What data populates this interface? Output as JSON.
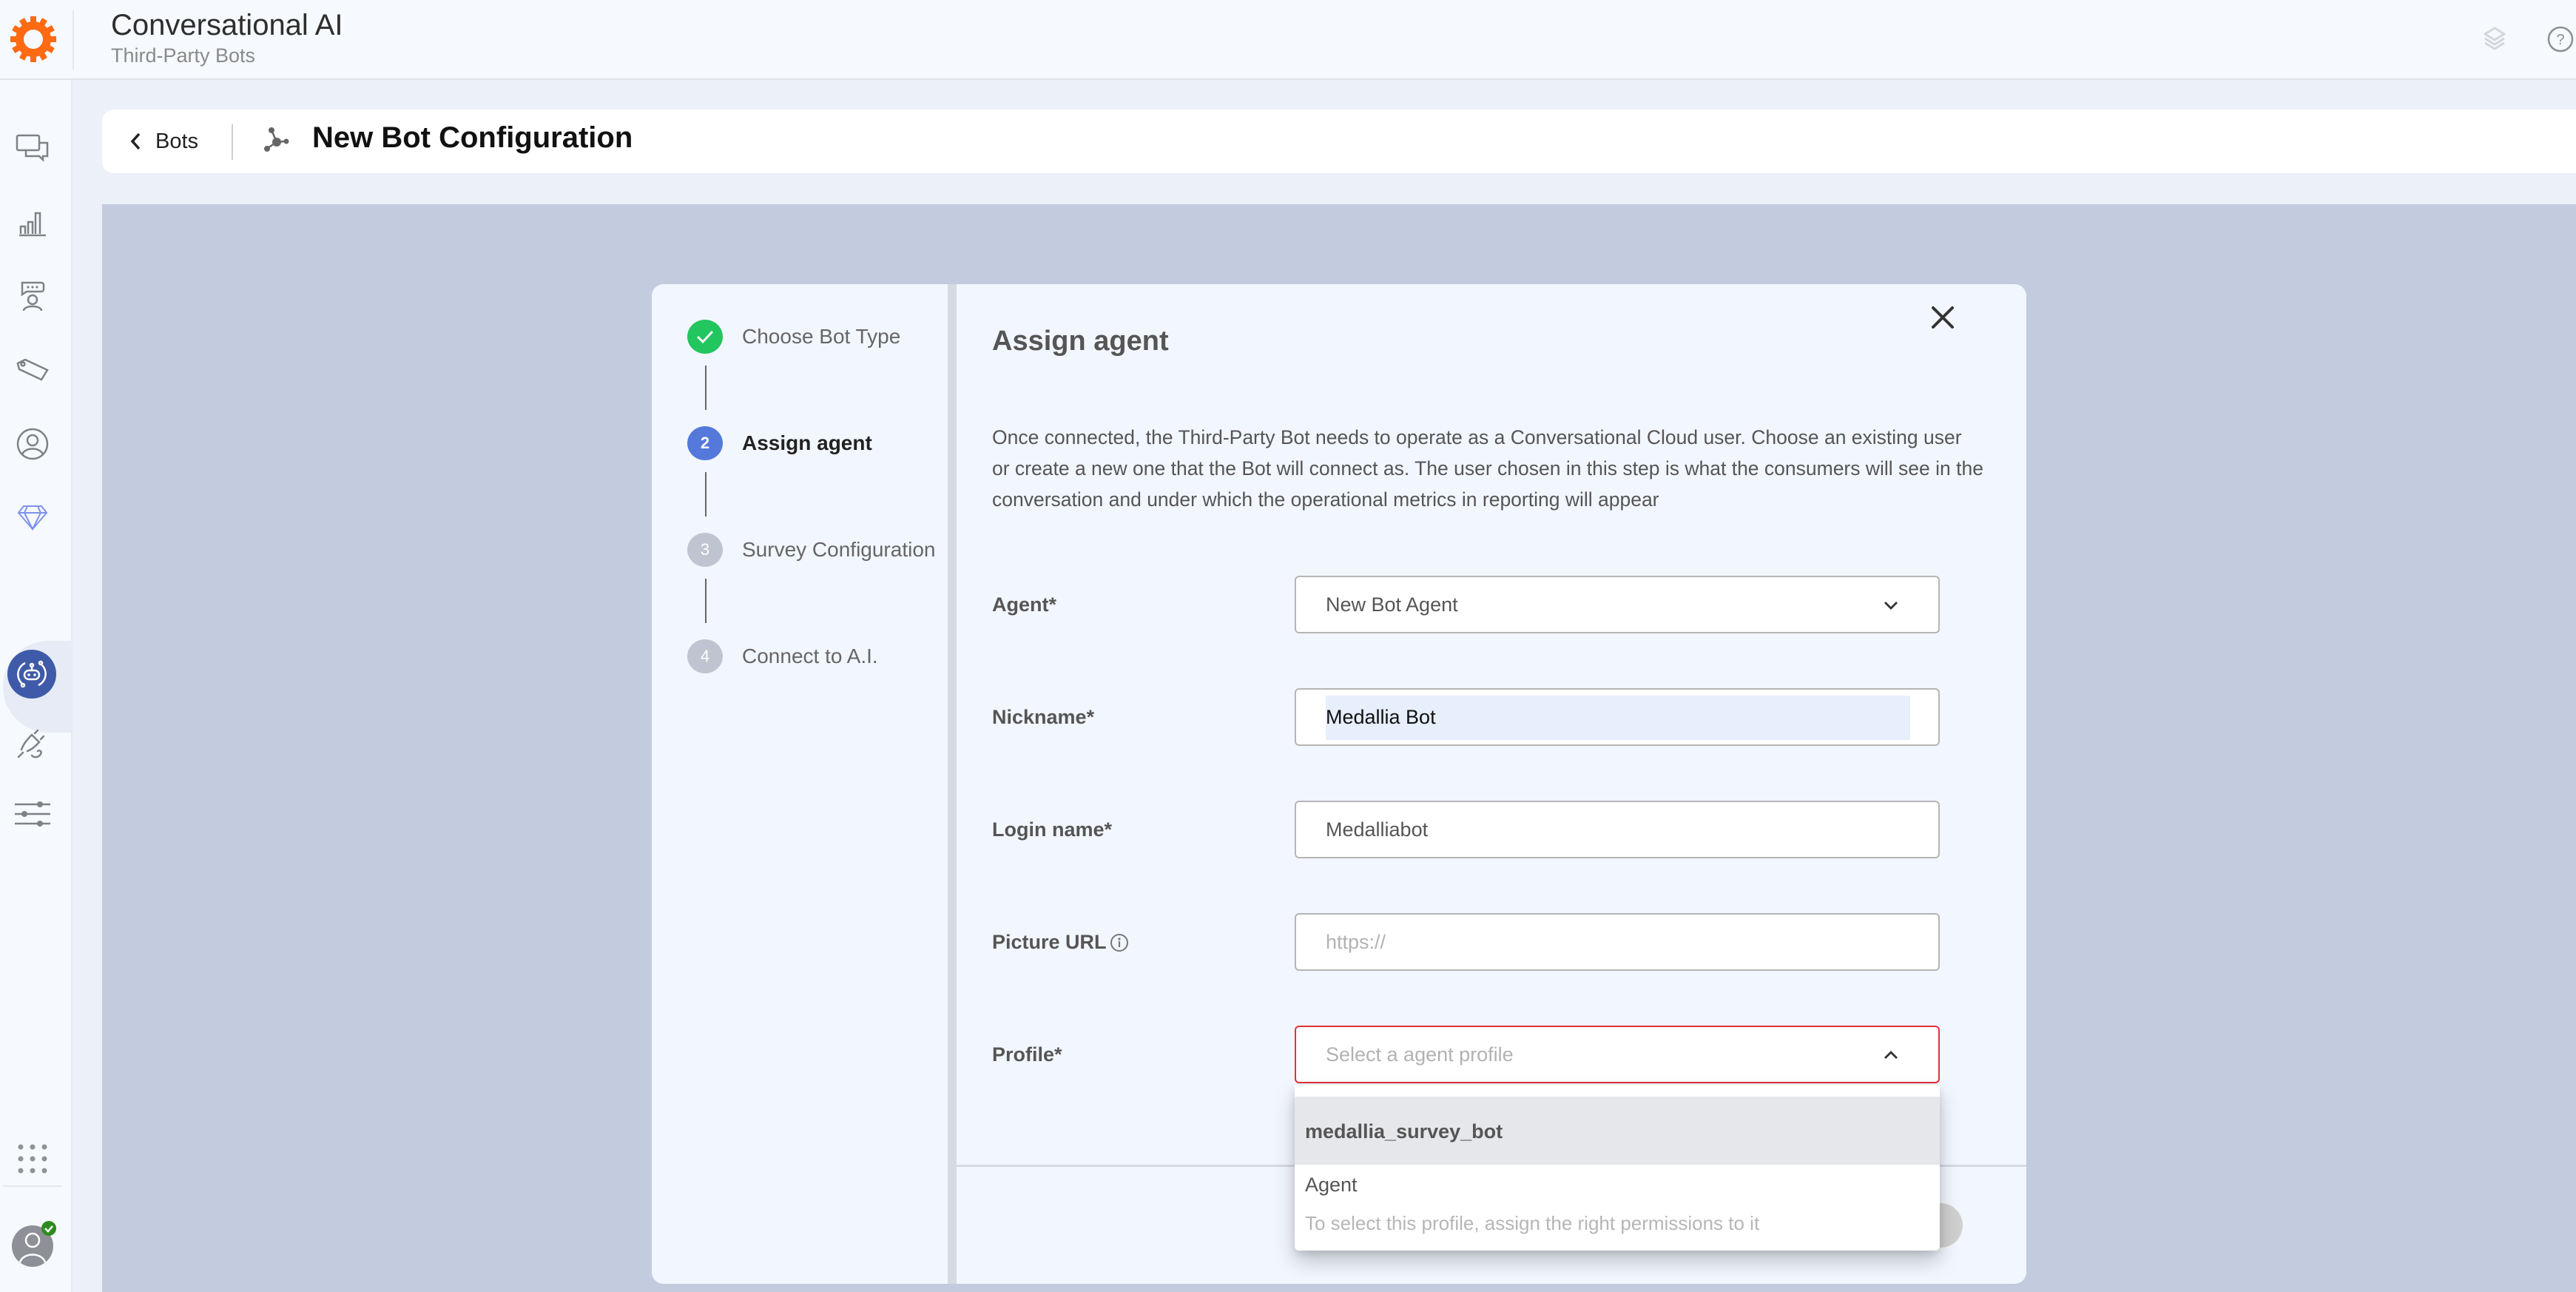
{
  "header": {
    "app_title": "Conversational AI",
    "app_subtitle": "Third-Party Bots",
    "icons": [
      "layers-icon",
      "help-icon"
    ]
  },
  "sidebar": {
    "items": [
      {
        "name": "conversations",
        "icon": "chat-bubbles-icon",
        "active": false
      },
      {
        "name": "analytics",
        "icon": "bar-chart-icon",
        "active": false
      },
      {
        "name": "agent-workspace",
        "icon": "agent-chat-icon",
        "active": false
      },
      {
        "name": "tags",
        "icon": "tag-icon",
        "active": false
      },
      {
        "name": "users",
        "icon": "user-circle-icon",
        "active": false
      },
      {
        "name": "premium",
        "icon": "diamond-icon",
        "active": false
      },
      {
        "name": "bots",
        "icon": "bot-icon",
        "active": true
      },
      {
        "name": "integrations",
        "icon": "plug-hand-icon",
        "active": false
      },
      {
        "name": "settings",
        "icon": "sliders-icon",
        "active": false
      }
    ],
    "bottom": [
      {
        "name": "apps",
        "icon": "grid-dots-icon"
      },
      {
        "name": "profile",
        "icon": "avatar-icon",
        "status": "online"
      }
    ]
  },
  "page": {
    "back_label": "Bots",
    "title": "New Bot Configuration"
  },
  "wizard": {
    "steps": [
      {
        "number": "1",
        "label": "Choose Bot Type",
        "state": "done"
      },
      {
        "number": "2",
        "label": "Assign agent",
        "state": "active"
      },
      {
        "number": "3",
        "label": "Survey Configuration",
        "state": "pending"
      },
      {
        "number": "4",
        "label": "Connect to A.I.",
        "state": "pending"
      }
    ]
  },
  "form": {
    "title": "Assign agent",
    "description": "Once connected, the Third-Party Bot needs to operate as a Conversational Cloud user. Choose an existing user or create a new one that the Bot will connect as. The user chosen in this step is what the consumers will see in the conversation and under which the operational metrics in reporting will appear",
    "fields": {
      "agent": {
        "label": "Agent*",
        "value": "New Bot Agent"
      },
      "nickname": {
        "label": "Nickname*",
        "value": "Medallia Bot"
      },
      "login_name": {
        "label": "Login name*",
        "value": "Medalliabot"
      },
      "picture_url": {
        "label": "Picture URL",
        "value": "",
        "placeholder": "https://"
      },
      "profile": {
        "label": "Profile*",
        "value": "",
        "placeholder": "Select a agent profile",
        "open": true
      }
    },
    "profile_options": [
      {
        "label": "medallia_survey_bot",
        "highlighted": true,
        "disabled": false
      },
      {
        "label": "Agent",
        "hint": "To select this profile, assign the right permissions to it",
        "disabled": true
      }
    ]
  },
  "colors": {
    "brand_orange": "#FF6A13",
    "active_step": "#5479DA",
    "done_step": "#22C55E",
    "error_border": "#E0323C",
    "active_nav": "#3F5AA8"
  }
}
